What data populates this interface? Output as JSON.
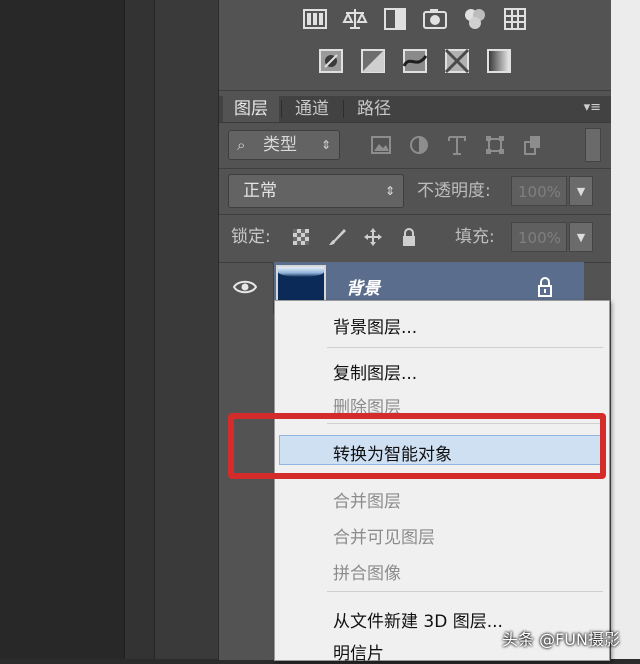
{
  "layers_panel": {
    "tabs": [
      {
        "label": "图层",
        "active": true
      },
      {
        "label": "通道",
        "active": false
      },
      {
        "label": "路径",
        "active": false
      }
    ],
    "filter": {
      "type_label": "类型"
    },
    "blend_mode": "正常",
    "opacity_label": "不透明度:",
    "opacity_value": "100%",
    "lock_label": "锁定:",
    "fill_label": "填充:",
    "fill_value": "100%",
    "layer": {
      "name": "背景",
      "visible": true,
      "locked": true
    }
  },
  "context_menu": {
    "items": [
      {
        "label": "背景图层...",
        "enabled": true
      },
      {
        "label": "复制图层...",
        "enabled": true
      },
      {
        "label": "删除图层",
        "enabled": false
      },
      {
        "label": "转换为智能对象",
        "enabled": true,
        "highlighted": true
      },
      {
        "label": "合并图层",
        "enabled": false
      },
      {
        "label": "合并可见图层",
        "enabled": false
      },
      {
        "label": "拼合图像",
        "enabled": false
      },
      {
        "label": "从文件新建 3D 图层...",
        "enabled": true
      },
      {
        "label": "明信片",
        "enabled": true
      }
    ]
  },
  "annotation": {
    "color": "#d42b2b"
  },
  "watermark": "头条 @FUN摄影",
  "colors": {
    "panel_bg": "#535353",
    "selected_layer": "#5b6d8c",
    "menu_highlight": "#cfe0f3"
  }
}
